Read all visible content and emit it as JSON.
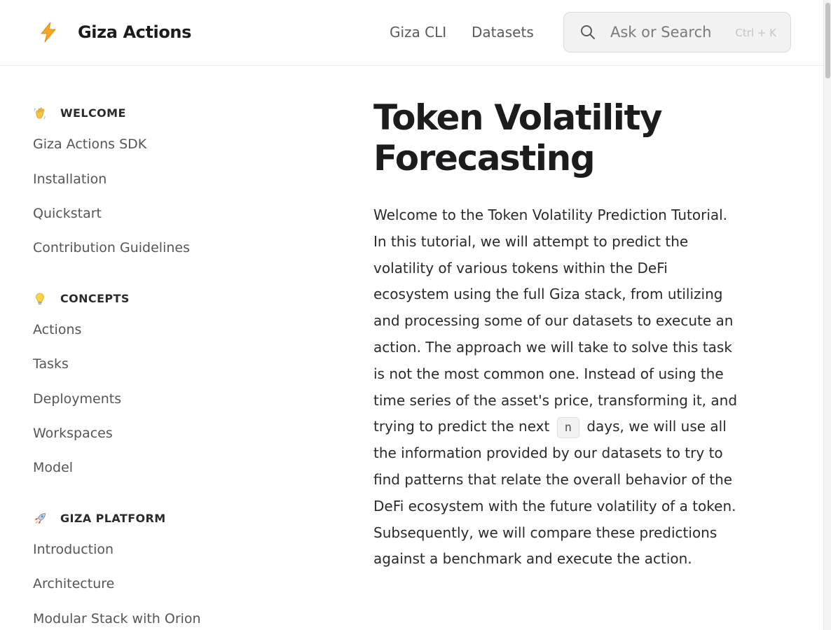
{
  "header": {
    "site_title": "Giza Actions",
    "logo_icon": "lightning-bolt-icon",
    "nav": [
      {
        "label": "Giza CLI"
      },
      {
        "label": "Datasets"
      }
    ],
    "search": {
      "placeholder": "Ask or Search",
      "shortcut": "Ctrl + K"
    }
  },
  "sidebar": {
    "sections": [
      {
        "icon": "waving-hand-icon",
        "title": "WELCOME",
        "items": [
          {
            "label": "Giza Actions SDK"
          },
          {
            "label": "Installation"
          },
          {
            "label": "Quickstart"
          },
          {
            "label": "Contribution Guidelines"
          }
        ]
      },
      {
        "icon": "light-bulb-icon",
        "title": "CONCEPTS",
        "items": [
          {
            "label": "Actions"
          },
          {
            "label": "Tasks"
          },
          {
            "label": "Deployments"
          },
          {
            "label": "Workspaces"
          },
          {
            "label": "Model"
          }
        ]
      },
      {
        "icon": "rocket-icon",
        "title": "GIZA PLATFORM",
        "items": [
          {
            "label": "Introduction"
          },
          {
            "label": "Architecture"
          },
          {
            "label": "Modular Stack with Orion"
          }
        ]
      }
    ]
  },
  "main": {
    "title": "Token Volatility Forecasting",
    "intro_before": "Welcome to the Token Volatility Prediction Tutorial. In this tutorial, we will attempt to predict the volatility of various tokens within the DeFi ecosystem using the full Giza stack, from utilizing and processing some of our datasets to execute an action. The approach we will take to solve this task is not the most common one. Instead of using the time series of the asset's price, transforming it, and trying to predict the next",
    "intro_code": "n",
    "intro_after": "days, we will use all the information provided by our datasets to try to find patterns that relate the overall behavior of the DeFi ecosystem with the future volatility of a token. Subsequently, we will compare these predictions against a benchmark and execute the action."
  },
  "colors": {
    "accent_logo": "#f5a623",
    "text_primary": "#1c1c1e",
    "text_secondary": "#55555a",
    "search_bg": "#f2f2f3"
  }
}
